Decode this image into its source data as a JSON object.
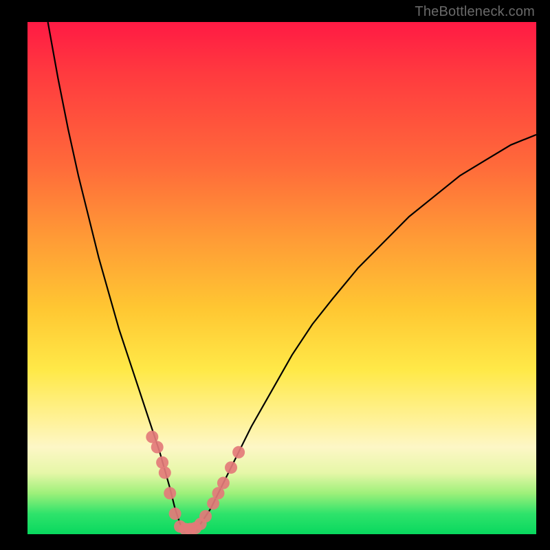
{
  "watermark": {
    "text": "TheBottleneck.com"
  },
  "colors": {
    "gradient_top": "#ff1a44",
    "gradient_mid1": "#ff9a36",
    "gradient_mid2": "#ffe948",
    "gradient_bottom": "#08d85e",
    "curve_stroke": "#000000",
    "marker_fill": "#e37a7a",
    "frame": "#000000"
  },
  "chart_data": {
    "type": "line",
    "title": "",
    "xlabel": "",
    "ylabel": "",
    "xlim": [
      0,
      100
    ],
    "ylim": [
      0,
      100
    ],
    "grid": false,
    "legend": false,
    "series": [
      {
        "name": "bottleneck-curve",
        "x": [
          4,
          6,
          8,
          10,
          12,
          14,
          16,
          18,
          20,
          22,
          24,
          26,
          28,
          29,
          30,
          31,
          32,
          34,
          36,
          38,
          40,
          44,
          48,
          52,
          56,
          60,
          65,
          70,
          75,
          80,
          85,
          90,
          95,
          100
        ],
        "y": [
          100,
          89,
          79,
          70,
          62,
          54,
          47,
          40,
          34,
          28,
          22,
          16,
          9,
          5,
          2,
          1,
          1,
          2,
          5,
          9,
          13,
          21,
          28,
          35,
          41,
          46,
          52,
          57,
          62,
          66,
          70,
          73,
          76,
          78
        ]
      }
    ],
    "markers": {
      "name": "highlighted-points",
      "x": [
        24.5,
        25.5,
        26.5,
        27.0,
        28.0,
        29.0,
        30.0,
        31.0,
        32.0,
        33.0,
        34.0,
        35.0,
        36.5,
        37.5,
        38.5,
        40.0,
        41.5
      ],
      "y": [
        19,
        17,
        14,
        12,
        8,
        4,
        1.5,
        1,
        1,
        1.2,
        2,
        3.5,
        6,
        8,
        10,
        13,
        16
      ]
    }
  }
}
